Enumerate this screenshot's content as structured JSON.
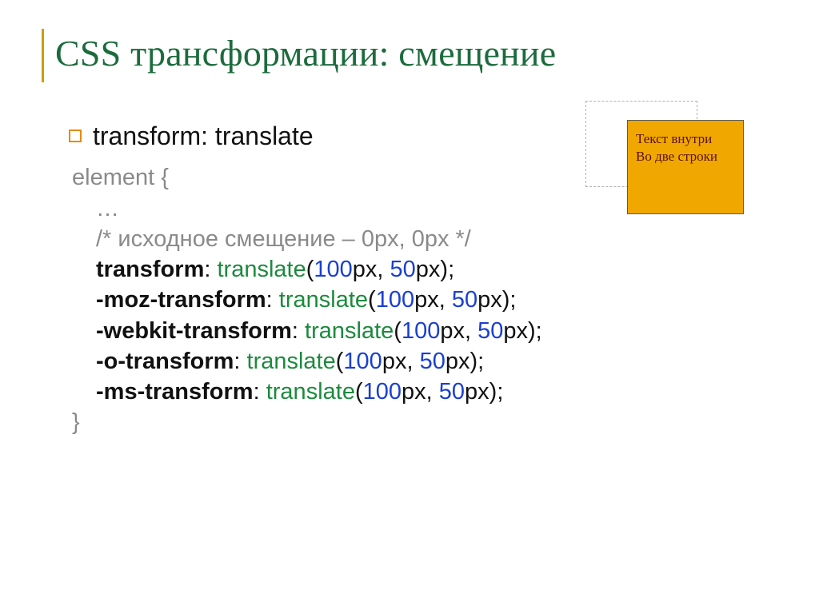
{
  "title": "CSS трансформации: смещение",
  "bullet": "transform: translate",
  "code": {
    "open": "element {",
    "ellipsis": "…",
    "comment": "/* исходное смещение – 0px, 0px */",
    "lines": [
      {
        "prop": "transform",
        "func": "translate",
        "v1": "100",
        "u1": "px, ",
        "v2": "50",
        "u2": "px);"
      },
      {
        "prop": "-moz-transform",
        "func": "translate",
        "v1": "100",
        "u1": "px, ",
        "v2": "50",
        "u2": "px);"
      },
      {
        "prop": "-webkit-transform",
        "func": "translate",
        "v1": "100",
        "u1": "px, ",
        "v2": "50",
        "u2": "px);"
      },
      {
        "prop": "-o-transform",
        "func": "translate",
        "v1": "100",
        "u1": "px, ",
        "v2": "50",
        "u2": "px);"
      },
      {
        "prop": "-ms-transform",
        "func": "translate",
        "v1": "100",
        "u1": "px, ",
        "v2": "50",
        "u2": "px);"
      }
    ],
    "close": "}"
  },
  "demo": {
    "line1": "Текст внутри",
    "line2": "Во две строки"
  }
}
